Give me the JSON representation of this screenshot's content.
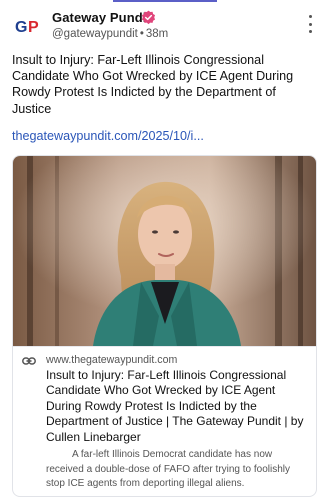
{
  "author": {
    "name": "Gateway Pundit",
    "handle": "@gatewaypundit",
    "separator": "•",
    "time": "38m",
    "avatar_text": "GP"
  },
  "post": {
    "text": "Insult to Injury: Far-Left Illinois Congressional Candidate Who Got Wrecked by ICE Agent During Rowdy Protest Is Indicted by the Department of Justice",
    "link": "thegatewaypundit.com/2025/10/i..."
  },
  "card": {
    "domain": "www.thegatewaypundit.com",
    "title": "Insult to Injury: Far-Left Illinois Congressional Candidate Who Got Wrecked by ICE Agent During Rowdy Protest Is Indicted by the Department of Justice | The Gateway Pundit | by Cullen Linebarger",
    "description": "A far-left Illinois Democrat candidate has now received a double-dose of FAFO after trying to foolishly stop ICE agents from deporting illegal aliens."
  },
  "colors": {
    "accent": "#5b5fc7",
    "link": "#2b56b8",
    "verified_badge": "#e0457b",
    "logo_blue": "#1f3f8f",
    "logo_red": "#d9272e"
  },
  "icons": {
    "verified": "verified-badge-icon",
    "menu": "more-vertical-icon",
    "link": "link-icon"
  }
}
